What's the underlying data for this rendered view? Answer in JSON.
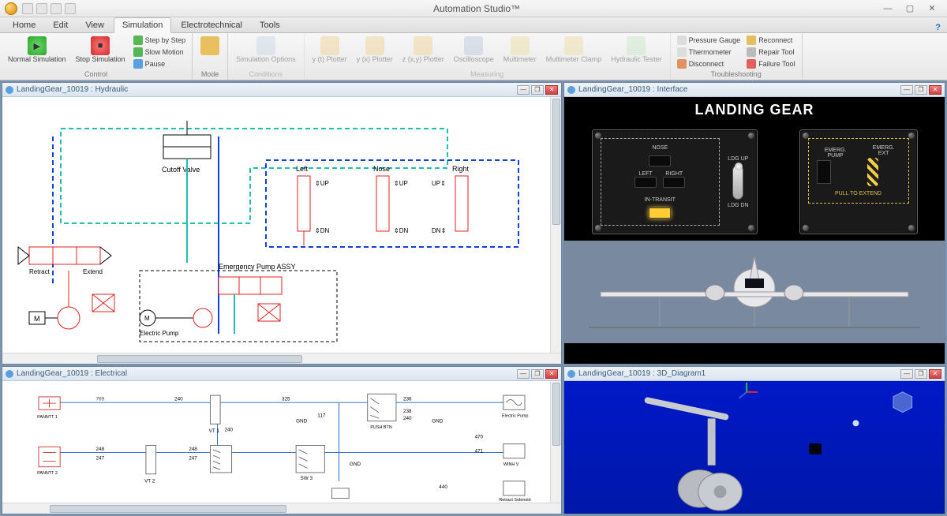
{
  "app": {
    "title": "Automation Studio™"
  },
  "menutabs": [
    "Home",
    "Edit",
    "View",
    "Simulation",
    "Electrotechnical",
    "Tools"
  ],
  "active_tab": "Simulation",
  "ribbon": {
    "control": {
      "label": "Control",
      "normal": "Normal Simulation",
      "stop": "Stop Simulation",
      "step": "Step by Step",
      "slow": "Slow Motion",
      "pause": "Pause"
    },
    "mode": {
      "label": "Mode",
      "btn": ""
    },
    "conditions": {
      "label": "Conditions",
      "simopt": "Simulation Options"
    },
    "measuring": {
      "label": "Measuring",
      "yt": "y (t) Plotter",
      "yx": "y (x) Plotter",
      "zxy": "z (x,y) Plotter",
      "osc": "Oscilloscope",
      "mm": "Multimeter",
      "mc": "Multimeter Clamp",
      "ht": "Hydraulic Tester"
    },
    "trouble": {
      "label": "Troubleshooting",
      "pg": "Pressure Gauge",
      "th": "Thermometer",
      "dc": "Disconnect",
      "rc": "Reconnect",
      "rt": "Repair Tool",
      "ft": "Failure Tool"
    }
  },
  "panes": {
    "hydraulic": {
      "title": "LandingGear_10019 : Hydraulic",
      "labels": {
        "cutoff": "Cutoff Valve",
        "left": "Left",
        "nose": "Nose",
        "right": "Right",
        "up": "UP",
        "dn": "DN",
        "retract": "Retract",
        "extend": "Extend",
        "epump_assy": "Emergency Pump ASSY",
        "electric_pump": "Electric Pump",
        "m": "M"
      }
    },
    "interface": {
      "title": "LandingGear_10019 : Interface",
      "heading": "LANDING GEAR",
      "left_panel": {
        "nose": "NOSE",
        "left": "LEFT",
        "right": "RIGHT",
        "intransit": "IN-TRANSIT",
        "ldg_up": "LDG UP",
        "ldg_dn": "LDG DN"
      },
      "right_panel": {
        "epump": "EMERG. PUMP",
        "eext": "EMERG. EXT",
        "pull": "PULL TO EXTEND"
      }
    },
    "electrical": {
      "title": "LandingGear_10019 : Electrical",
      "labels": {
        "pwr": "769",
        "n240a": "240",
        "n240b": "240",
        "n325": "325",
        "n236": "236",
        "n238": "238",
        "n240c": "240",
        "n117": "117",
        "gnd": "GND",
        "n470": "470",
        "n471": "471",
        "n440": "440",
        "vt1": "VT 1",
        "vt2": "VT 2",
        "n248": "248",
        "n247": "247",
        "n248b": "248",
        "n247b": "247",
        "sw3": "SW 3",
        "pushbtn": "PUSH BTN",
        "epump": "Electric Pump",
        "retract_sol": "Retract Solenoid",
        "rb1": "PANNTT 1",
        "rb2": "PANNTT 2",
        "winh": "WINH V"
      }
    },
    "threeD": {
      "title": "LandingGear_10019 : 3D_Diagram1"
    }
  }
}
